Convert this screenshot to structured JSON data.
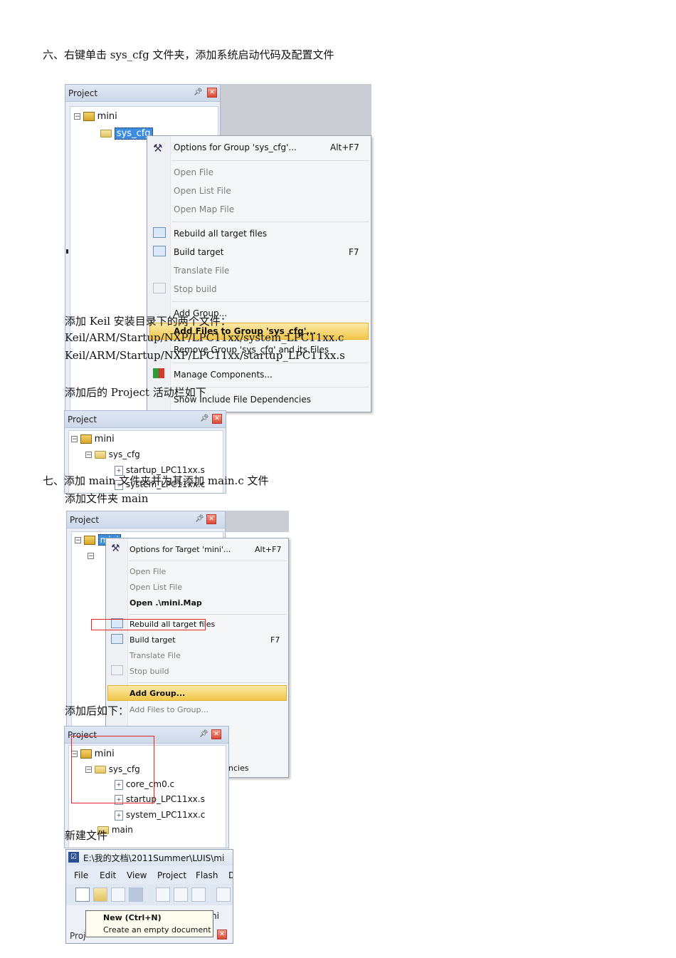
{
  "section6": {
    "heading": "六、右键单击 sys_cfg 文件夹，添加系统启动代码及配置文件",
    "note_line1": "添加 Keil 安装目录下的两个文件：",
    "note_line2": "Keil/ARM/Startup/NXP/LPC11xx/system_LPC11xx.c",
    "note_line3": "Keil/ARM/Startup/NXP/LPC11xx/startup_LPC11xx.s",
    "note_after": "添加后的 Project 活动栏如下"
  },
  "screenshot1": {
    "panel_title": "Project",
    "root": "mini",
    "selected_folder": "sys_cfg",
    "menu": {
      "options": "Options for Group 'sys_cfg'...",
      "options_key": "Alt+F7",
      "open_file": "Open File",
      "open_list": "Open List File",
      "open_map": "Open Map File",
      "rebuild": "Rebuild all target files",
      "build": "Build target",
      "build_key": "F7",
      "translate": "Translate File",
      "stop": "Stop build",
      "add_group": "Add Group...",
      "add_files": "Add Files to Group 'sys_cfg'...",
      "remove_group": "Remove Group 'sys_cfg' and its Files",
      "manage": "Manage Components...",
      "show_deps": "Show Include File Dependencies"
    }
  },
  "screenshot2": {
    "panel_title": "Project",
    "root": "mini",
    "folder": "sys_cfg",
    "file1": "startup_LPC11xx.s",
    "file2": "system_LPC11xx.c"
  },
  "section7": {
    "heading": "七、添加 main 文件夹并为其添加 main.c 文件",
    "sub_heading": "添加文件夹 main",
    "after_label": "添加后如下：",
    "new_file_label": "新建文件"
  },
  "screenshot3": {
    "panel_title": "Project",
    "root": "mini",
    "menu": {
      "options": "Options for Target 'mini'...",
      "options_key": "Alt+F7",
      "open_file": "Open File",
      "open_list": "Open List File",
      "open_map": "Open .\\mini.Map",
      "rebuild": "Rebuild all target files",
      "build": "Build target",
      "build_key": "F7",
      "translate": "Translate File",
      "stop": "Stop build",
      "add_group": "Add Group...",
      "add_files": "Add Files to Group...",
      "deps_tail": "ncies"
    }
  },
  "screenshot4": {
    "panel_title": "Project",
    "root": "mini",
    "folder": "sys_cfg",
    "file1": "core_cm0.c",
    "file2": "startup_LPC11xx.s",
    "file3": "system_LPC11xx.c",
    "folder2": "main"
  },
  "screenshot5": {
    "window_title": "E:\\我的文档\\2011Summer\\LUIS\\mi",
    "menu_file": "File",
    "menu_edit": "Edit",
    "menu_view": "View",
    "menu_project": "Project",
    "menu_flash": "Flash",
    "menu_more": "D",
    "tooltip_title": "New (Ctrl+N)",
    "tooltip_desc": "Create an empty document",
    "tree_tail": "ni",
    "panel_title_partial": "Proj"
  },
  "colors": {
    "accent": "#3d8ee0",
    "highlight": "#f2c84b",
    "red_box": "#e0262b"
  }
}
